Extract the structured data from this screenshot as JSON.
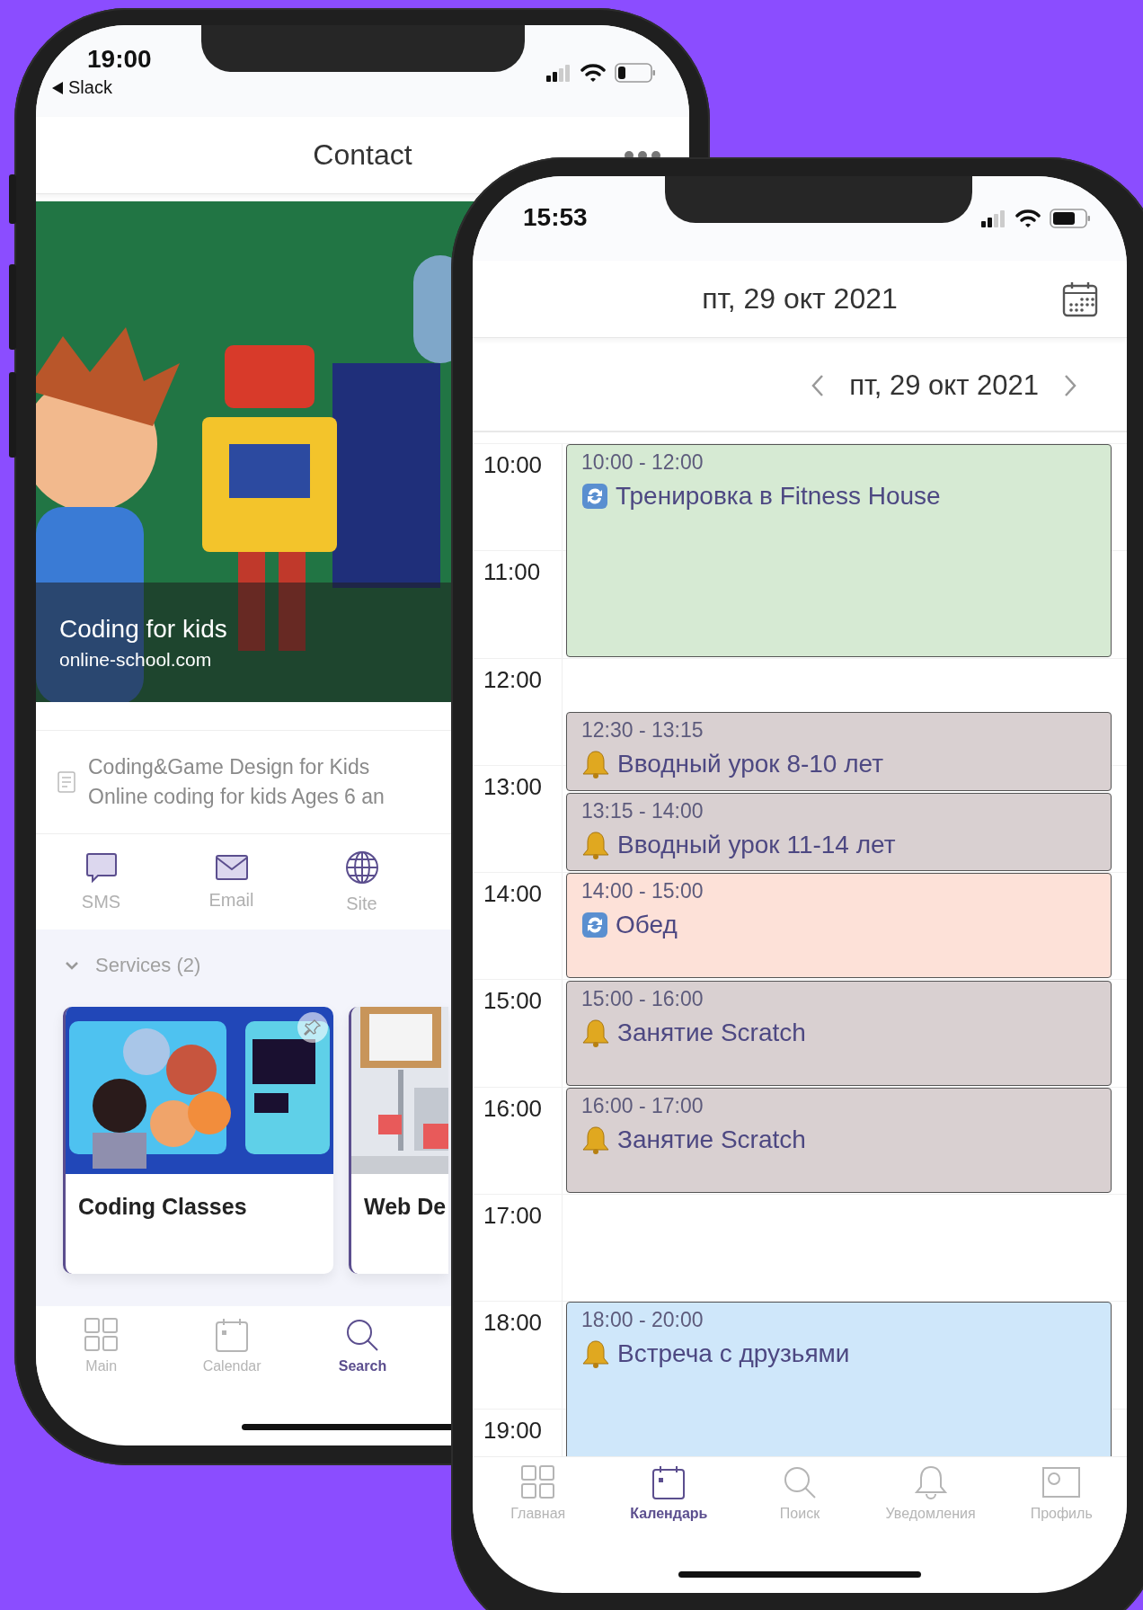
{
  "contact_screen": {
    "status_bar": {
      "time": "19:00",
      "back_label": "Slack"
    },
    "header": {
      "title": "Contact"
    },
    "banner": {
      "kind": "picture",
      "title": "Coding for kids",
      "subtitle": "online-school.com"
    },
    "info": {
      "lines": [
        "Coding&Game Design for Kids",
        "Online coding for kids Ages 6 an"
      ]
    },
    "actions": [
      {
        "kind": "sms",
        "label": "SMS"
      },
      {
        "kind": "email",
        "label": "Email"
      },
      {
        "kind": "site",
        "label": "Site"
      }
    ],
    "services": {
      "label": "Services (2)",
      "expanded": true
    },
    "cards": [
      {
        "title": "Coding Classes",
        "kind": "people"
      },
      {
        "title": "Web De",
        "kind": "machine"
      }
    ],
    "tabs": [
      {
        "kind": "grid",
        "label": "Main",
        "selected": false
      },
      {
        "kind": "calendar",
        "label": "Calendar",
        "selected": false
      },
      {
        "kind": "search",
        "label": "Search",
        "selected": true
      }
    ]
  },
  "calendar_screen": {
    "status_bar": {
      "time": "15:53"
    },
    "header": {
      "title": "пт, 29 окт 2021"
    },
    "date_nav": {
      "label": "пт, 29 окт 2021"
    },
    "hours": [
      "10:00",
      "11:00",
      "12:00",
      "13:00",
      "14:00",
      "15:00",
      "16:00",
      "17:00",
      "18:00",
      "19:00"
    ],
    "events": [
      {
        "time": "10:00 - 12:00",
        "title": "Тренировка в Fitness House",
        "kind": "repeat",
        "color": "#d6ead3"
      },
      {
        "time": "12:30 - 13:15",
        "title": "Вводный урок 8-10 лет",
        "kind": "reminder",
        "color": "#d9d0d1"
      },
      {
        "time": "13:15 - 14:00",
        "title": "Вводный урок 11-14 лет",
        "kind": "reminder",
        "color": "#d9d0d1"
      },
      {
        "time": "14:00 - 15:00",
        "title": "Обед",
        "kind": "repeat",
        "color": "#fde1d8"
      },
      {
        "time": "15:00 - 16:00",
        "title": "Занятие Scratch",
        "kind": "reminder",
        "color": "#d9d0d1"
      },
      {
        "time": "16:00 - 17:00",
        "title": "Занятие Scratch",
        "kind": "reminder",
        "color": "#d9d0d1"
      },
      {
        "time": "18:00 - 20:00",
        "title": "Встреча с друзьями",
        "kind": "reminder",
        "color": "#cfe7fa"
      }
    ],
    "tabs": [
      {
        "kind": "grid",
        "label": "Главная",
        "selected": false
      },
      {
        "kind": "calendar",
        "label": "Календарь",
        "selected": true
      },
      {
        "kind": "search",
        "label": "Поиск",
        "selected": false
      },
      {
        "kind": "bell",
        "label": "Уведомления",
        "selected": false
      },
      {
        "kind": "profile",
        "label": "Профиль",
        "selected": false
      }
    ]
  }
}
